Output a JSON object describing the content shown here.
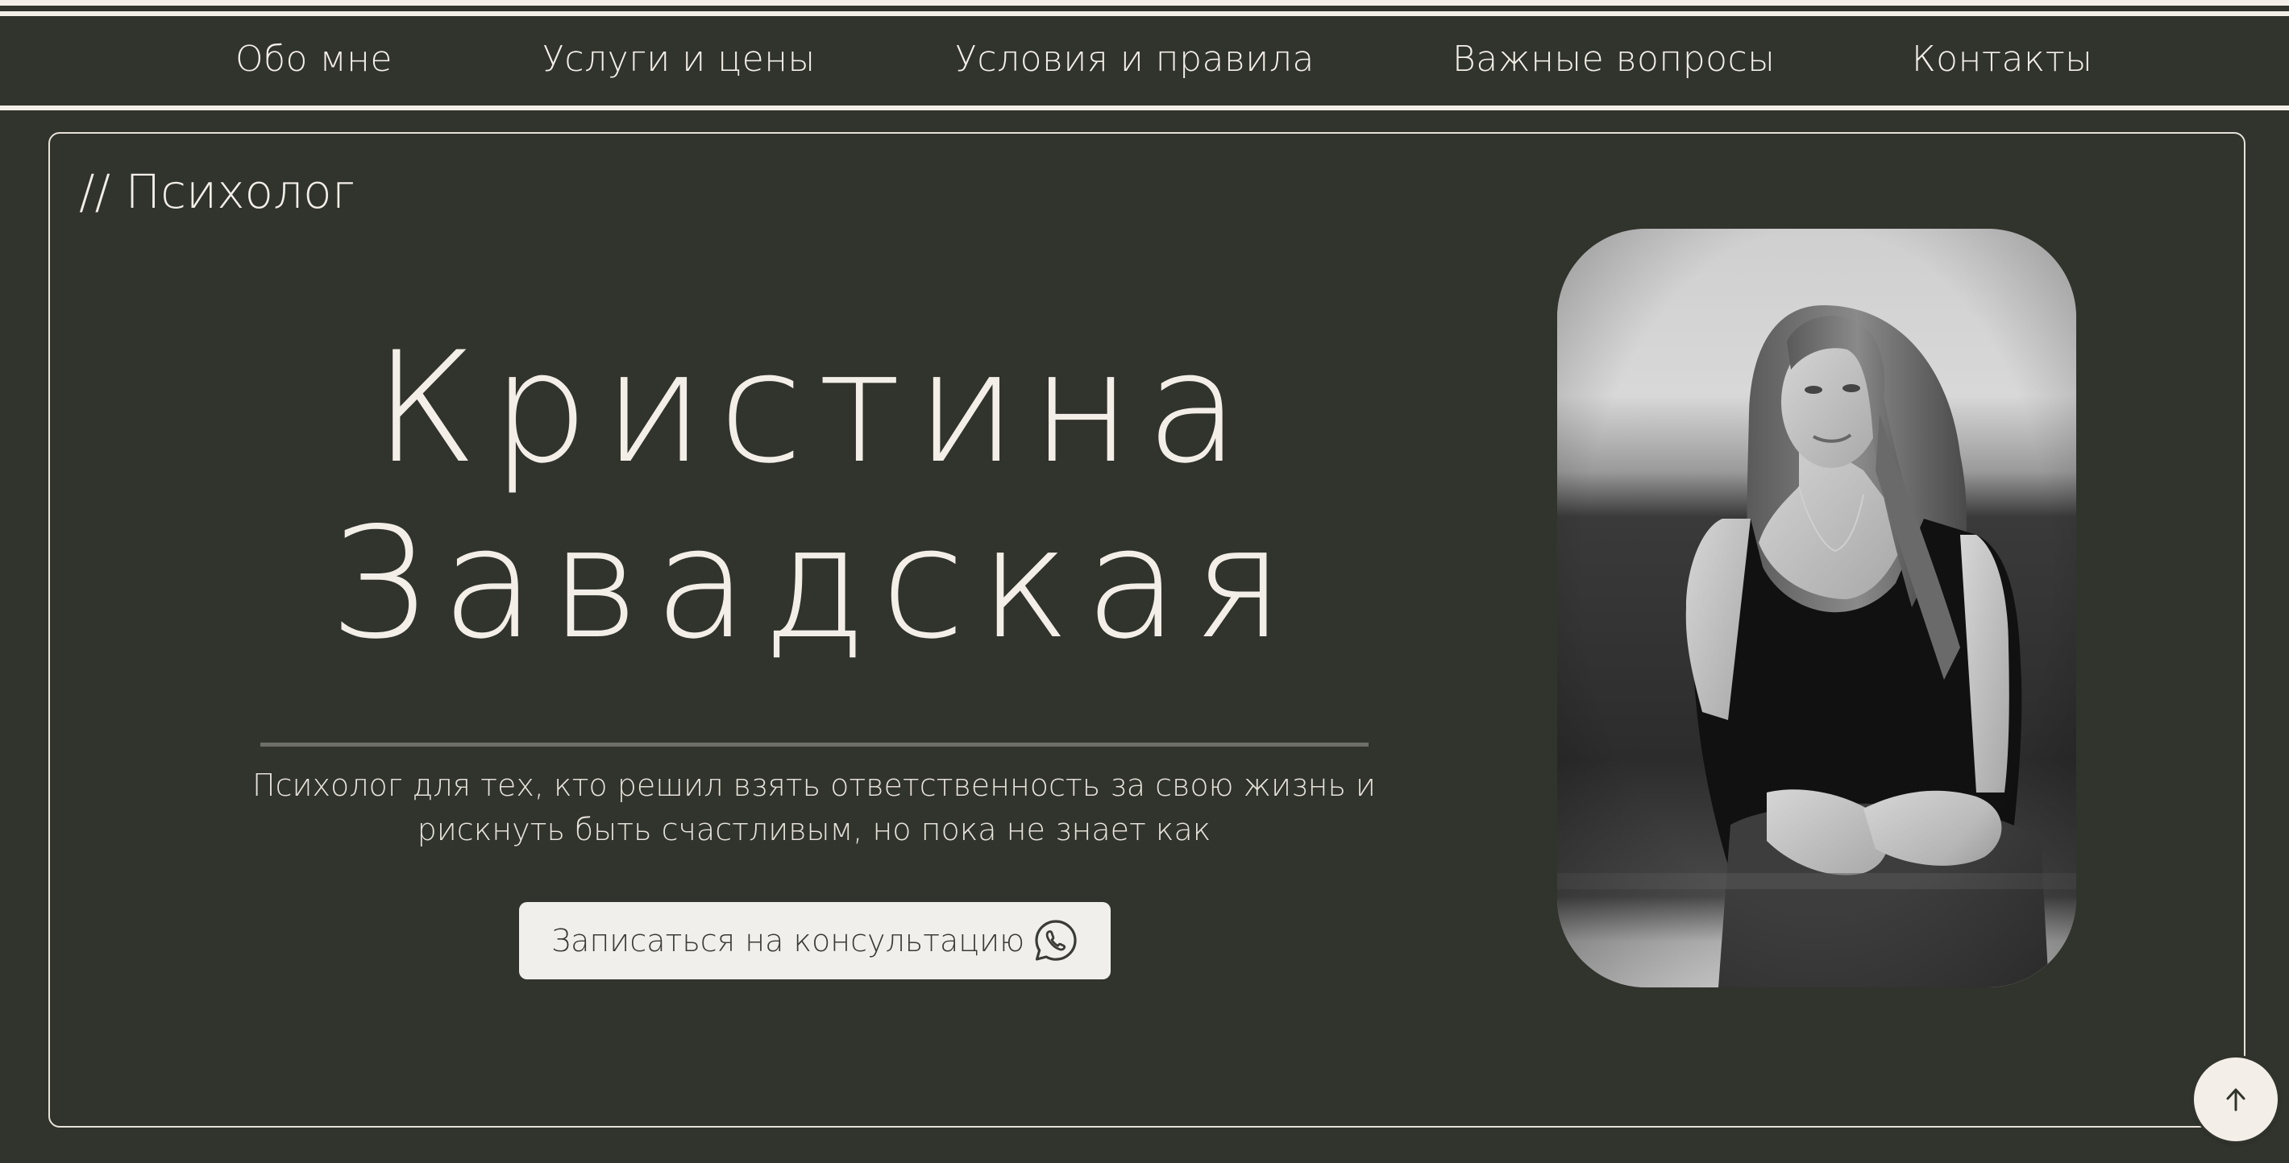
{
  "nav": {
    "items": [
      {
        "label": "Обо мне"
      },
      {
        "label": "Услуги и цены"
      },
      {
        "label": "Условия и правила"
      },
      {
        "label": "Важные вопросы"
      },
      {
        "label": "Контакты"
      }
    ]
  },
  "hero": {
    "eyebrow": "// Психолог",
    "name_first": "Кристина",
    "name_last": "Завадская",
    "subtitle_line1": "Психолог для тех, кто решил взять ответственность за свою жизнь и",
    "subtitle_line2": "рискнуть быть счастливым, но пока не знает как",
    "cta_label": "Записаться на консультацию",
    "cta_icon": "whatsapp-icon"
  },
  "scroll_top": {
    "icon": "arrow-up-icon"
  },
  "colors": {
    "background": "#31332d",
    "text": "#f3efe8",
    "button_bg": "#f1efec",
    "button_text": "#3a3b36"
  }
}
